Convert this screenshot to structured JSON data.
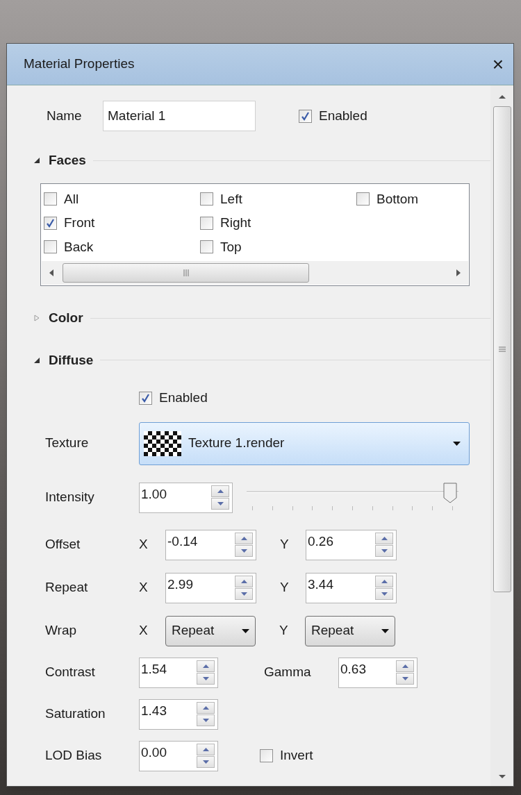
{
  "window": {
    "title": "Material Properties",
    "close": "×"
  },
  "name_field": {
    "label": "Name",
    "value": "Material 1"
  },
  "enabled": {
    "label": "Enabled",
    "checked": true
  },
  "sections": [
    {
      "kind": "faces",
      "title": "Faces",
      "expanded": true,
      "columns": [
        [
          {
            "label": "All",
            "checked": false
          },
          {
            "label": "Front",
            "checked": true
          },
          {
            "label": "Back",
            "checked": false
          }
        ],
        [
          {
            "label": "Left",
            "checked": false
          },
          {
            "label": "Right",
            "checked": false
          },
          {
            "label": "Top",
            "checked": false
          }
        ],
        [
          {
            "label": "Bottom",
            "checked": false
          }
        ]
      ]
    },
    {
      "kind": "color",
      "title": "Color",
      "expanded": false
    },
    {
      "kind": "diffuse",
      "title": "Diffuse",
      "expanded": true,
      "enabled": {
        "label": "Enabled",
        "checked": true
      },
      "texture": {
        "label": "Texture",
        "value": "Texture 1.render"
      },
      "intensity": {
        "label": "Intensity",
        "value": "1.00",
        "level": 0.96
      },
      "offset": {
        "label": "Offset",
        "x_label": "X",
        "x_value": "-0.14",
        "y_label": "Y",
        "y_value": "0.26"
      },
      "repeat": {
        "label": "Repeat",
        "x_label": "X",
        "x_value": "2.99",
        "y_label": "Y",
        "y_value": "3.44"
      },
      "wrap": {
        "label": "Wrap",
        "x_label": "X",
        "x_value": "Repeat",
        "y_label": "Y",
        "y_value": "Repeat"
      },
      "contrast": {
        "label": "Contrast",
        "value": "1.54"
      },
      "gamma": {
        "label": "Gamma",
        "value": "0.63"
      },
      "saturation": {
        "label": "Saturation",
        "value": "1.43"
      },
      "lod_bias": {
        "label": "LOD Bias",
        "value": "0.00"
      },
      "invert": {
        "label": "Invert",
        "checked": false
      }
    }
  ]
}
